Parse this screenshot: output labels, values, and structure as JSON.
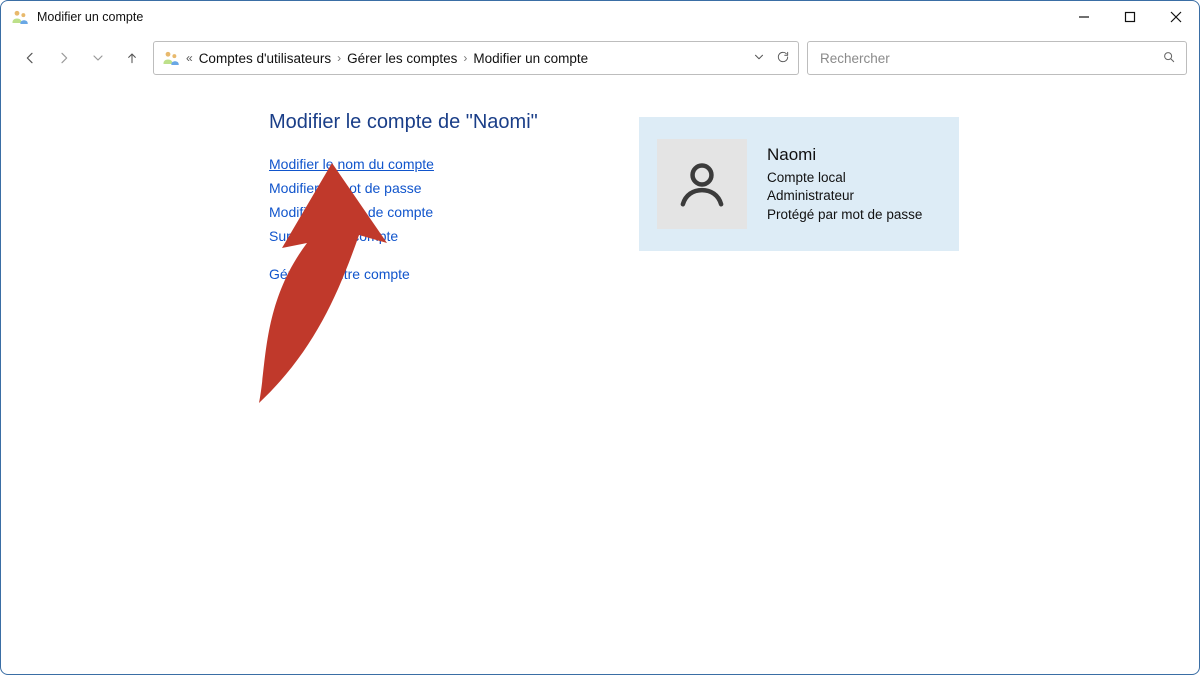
{
  "window": {
    "title": "Modifier un compte"
  },
  "breadcrumb": {
    "items": [
      "Comptes d'utilisateurs",
      "Gérer les comptes",
      "Modifier un compte"
    ]
  },
  "search": {
    "placeholder": "Rechercher"
  },
  "main": {
    "heading": "Modifier le compte de \"Naomi\"",
    "links": {
      "rename": "Modifier le nom du compte",
      "change_password": "Modifier le mot de passe",
      "change_type": "Modifier le type de compte",
      "delete": "Supprimer le compte",
      "manage_other": "Gérer un autre compte"
    }
  },
  "account": {
    "name": "Naomi",
    "kind": "Compte local",
    "role": "Administrateur",
    "protection": "Protégé par mot de passe"
  }
}
